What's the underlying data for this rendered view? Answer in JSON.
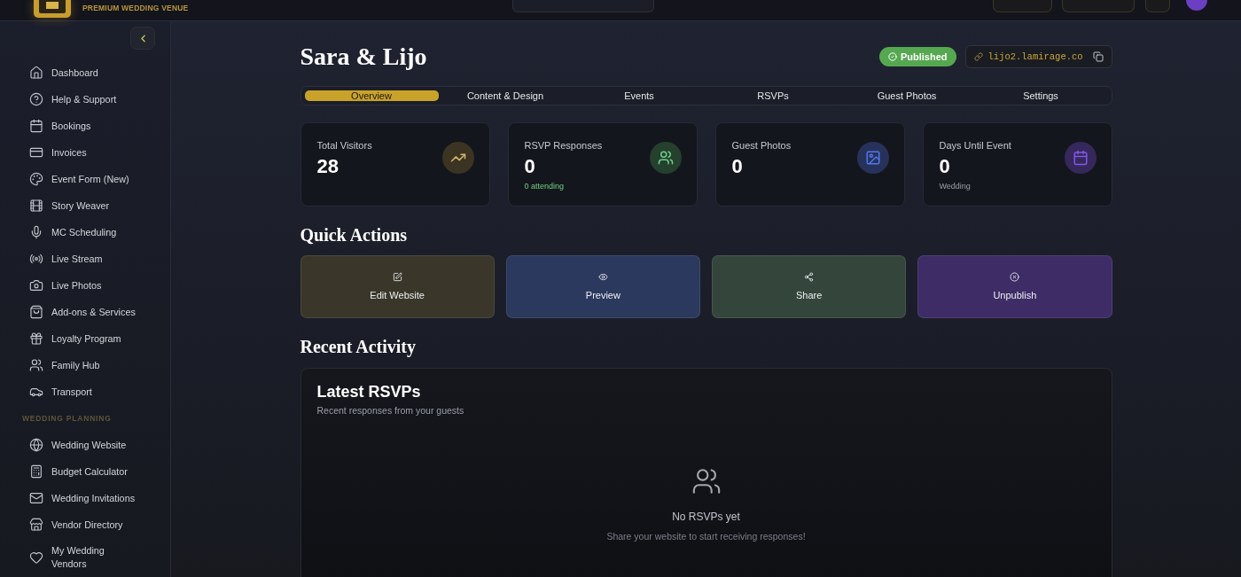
{
  "topbar": {
    "tagline": "PREMIUM WEDDING VENUE"
  },
  "sidebar": {
    "groups": [
      {
        "items": [
          {
            "label": "Dashboard"
          },
          {
            "label": "Help & Support"
          },
          {
            "label": "Bookings"
          },
          {
            "label": "Invoices"
          },
          {
            "label": "Event Form (New)"
          },
          {
            "label": "Story Weaver"
          },
          {
            "label": "MC Scheduling"
          },
          {
            "label": "Live Stream"
          },
          {
            "label": "Live Photos"
          },
          {
            "label": "Add-ons & Services"
          },
          {
            "label": "Loyalty Program"
          },
          {
            "label": "Family Hub"
          },
          {
            "label": "Transport"
          }
        ]
      },
      {
        "heading": "WEDDING PLANNING",
        "items": [
          {
            "label": "Wedding Website"
          },
          {
            "label": "Budget Calculator"
          },
          {
            "label": "Wedding Invitations"
          },
          {
            "label": "Vendor Directory"
          },
          {
            "label": "My Wedding Vendors"
          }
        ]
      }
    ]
  },
  "page": {
    "title": "Sara & Lijo",
    "status": "Published",
    "url": "lijo2.lamirage.co"
  },
  "tabs": [
    {
      "label": "Overview",
      "selected": true
    },
    {
      "label": "Content & Design",
      "selected": false
    },
    {
      "label": "Events",
      "selected": false
    },
    {
      "label": "RSVPs",
      "selected": false
    },
    {
      "label": "Guest Photos",
      "selected": false
    },
    {
      "label": "Settings",
      "selected": false
    }
  ],
  "stats": [
    {
      "label": "Total Visitors",
      "value": "28",
      "color": "#3b3422"
    },
    {
      "label": "RSVP Responses",
      "value": "0",
      "note": {
        "text": "0 attending",
        "kind": "positive"
      },
      "color": "#25402d"
    },
    {
      "label": "Guest Photos",
      "value": "0",
      "color": "#26325a"
    },
    {
      "label": "Days Until Event",
      "value": "0",
      "note": {
        "text": "Wedding",
        "kind": "muted"
      },
      "color": "#36285a"
    }
  ],
  "quick_actions": {
    "heading": "Quick Actions",
    "buttons": [
      {
        "label": "Edit Website",
        "color": "#3a3629"
      },
      {
        "label": "Preview",
        "color": "#2c395e"
      },
      {
        "label": "Share",
        "color": "#34463b"
      },
      {
        "label": "Unpublish",
        "color": "#3d2c66"
      }
    ]
  },
  "recent_activity": {
    "heading": "Recent Activity",
    "card": {
      "title": "Latest RSVPs",
      "subtitle": "Recent responses from your guests",
      "empty_title": "No RSVPs yet",
      "empty_message": "Share your website to start receiving responses!"
    }
  }
}
